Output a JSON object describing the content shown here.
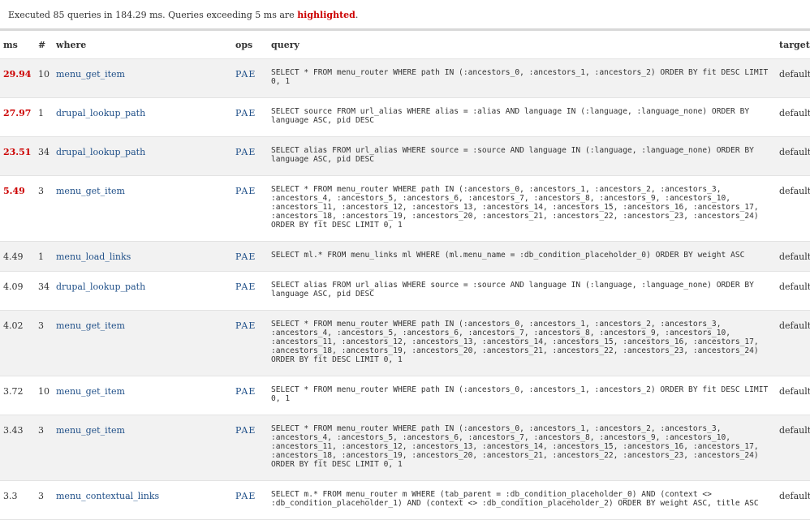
{
  "summary": {
    "prefix": "Executed 85 queries in 184.29 ms. Queries exceeding 5 ms are ",
    "highlight": "highlighted",
    "suffix": "."
  },
  "columns": {
    "ms": "ms",
    "count": "#",
    "where": "where",
    "ops": "ops",
    "query": "query",
    "target": "target"
  },
  "ops_links": {
    "p": "P",
    "a": "A",
    "e": "E"
  },
  "colors": {
    "slow": "#cc0000",
    "link": "#1f4f88"
  },
  "rows": [
    {
      "ms": "29.94",
      "slow": true,
      "count": "10",
      "where": "menu_get_item",
      "query": "SELECT * FROM menu_router WHERE path IN (:ancestors_0, :ancestors_1, :ancestors_2) ORDER BY fit DESC LIMIT 0, 1",
      "target": "default"
    },
    {
      "ms": "27.97",
      "slow": true,
      "count": "1",
      "where": "drupal_lookup_path",
      "query": "SELECT source FROM url_alias WHERE alias = :alias AND language IN (:language, :language_none) ORDER BY language ASC, pid DESC",
      "target": "default"
    },
    {
      "ms": "23.51",
      "slow": true,
      "count": "34",
      "where": "drupal_lookup_path",
      "query": "SELECT alias FROM url_alias WHERE source = :source AND language IN (:language, :language_none) ORDER BY language ASC, pid DESC",
      "target": "default"
    },
    {
      "ms": "5.49",
      "slow": true,
      "count": "3",
      "where": "menu_get_item",
      "query": "SELECT * FROM menu_router WHERE path IN (:ancestors_0, :ancestors_1, :ancestors_2, :ancestors_3, :ancestors_4, :ancestors_5, :ancestors_6, :ancestors_7, :ancestors_8, :ancestors_9, :ancestors_10, :ancestors_11, :ancestors_12, :ancestors_13, :ancestors_14, :ancestors_15, :ancestors_16, :ancestors_17, :ancestors_18, :ancestors_19, :ancestors_20, :ancestors_21, :ancestors_22, :ancestors_23, :ancestors_24) ORDER BY fit DESC LIMIT 0, 1",
      "target": "default"
    },
    {
      "ms": "4.49",
      "slow": false,
      "count": "1",
      "where": "menu_load_links",
      "query": "SELECT ml.* FROM menu_links ml WHERE (ml.menu_name = :db_condition_placeholder_0) ORDER BY weight ASC",
      "target": "default"
    },
    {
      "ms": "4.09",
      "slow": false,
      "count": "34",
      "where": "drupal_lookup_path",
      "query": "SELECT alias FROM url_alias WHERE source = :source AND language IN (:language, :language_none) ORDER BY language ASC, pid DESC",
      "target": "default"
    },
    {
      "ms": "4.02",
      "slow": false,
      "count": "3",
      "where": "menu_get_item",
      "query": "SELECT * FROM menu_router WHERE path IN (:ancestors_0, :ancestors_1, :ancestors_2, :ancestors_3, :ancestors_4, :ancestors_5, :ancestors_6, :ancestors_7, :ancestors_8, :ancestors_9, :ancestors_10, :ancestors_11, :ancestors_12, :ancestors_13, :ancestors_14, :ancestors_15, :ancestors_16, :ancestors_17, :ancestors_18, :ancestors_19, :ancestors_20, :ancestors_21, :ancestors_22, :ancestors_23, :ancestors_24) ORDER BY fit DESC LIMIT 0, 1",
      "target": "default"
    },
    {
      "ms": "3.72",
      "slow": false,
      "count": "10",
      "where": "menu_get_item",
      "query": "SELECT * FROM menu_router WHERE path IN (:ancestors_0, :ancestors_1, :ancestors_2) ORDER BY fit DESC LIMIT 0, 1",
      "target": "default"
    },
    {
      "ms": "3.43",
      "slow": false,
      "count": "3",
      "where": "menu_get_item",
      "query": "SELECT * FROM menu_router WHERE path IN (:ancestors_0, :ancestors_1, :ancestors_2, :ancestors_3, :ancestors_4, :ancestors_5, :ancestors_6, :ancestors_7, :ancestors_8, :ancestors_9, :ancestors_10, :ancestors_11, :ancestors_12, :ancestors_13, :ancestors_14, :ancestors_15, :ancestors_16, :ancestors_17, :ancestors_18, :ancestors_19, :ancestors_20, :ancestors_21, :ancestors_22, :ancestors_23, :ancestors_24) ORDER BY fit DESC LIMIT 0, 1",
      "target": "default"
    },
    {
      "ms": "3.3",
      "slow": false,
      "count": "3",
      "where": "menu_contextual_links",
      "query": "SELECT m.* FROM menu_router m WHERE (tab_parent = :db_condition_placeholder_0) AND (context <> :db_condition_placeholder_1) AND (context <> :db_condition_placeholder_2) ORDER BY weight ASC, title ASC",
      "target": "default"
    }
  ]
}
